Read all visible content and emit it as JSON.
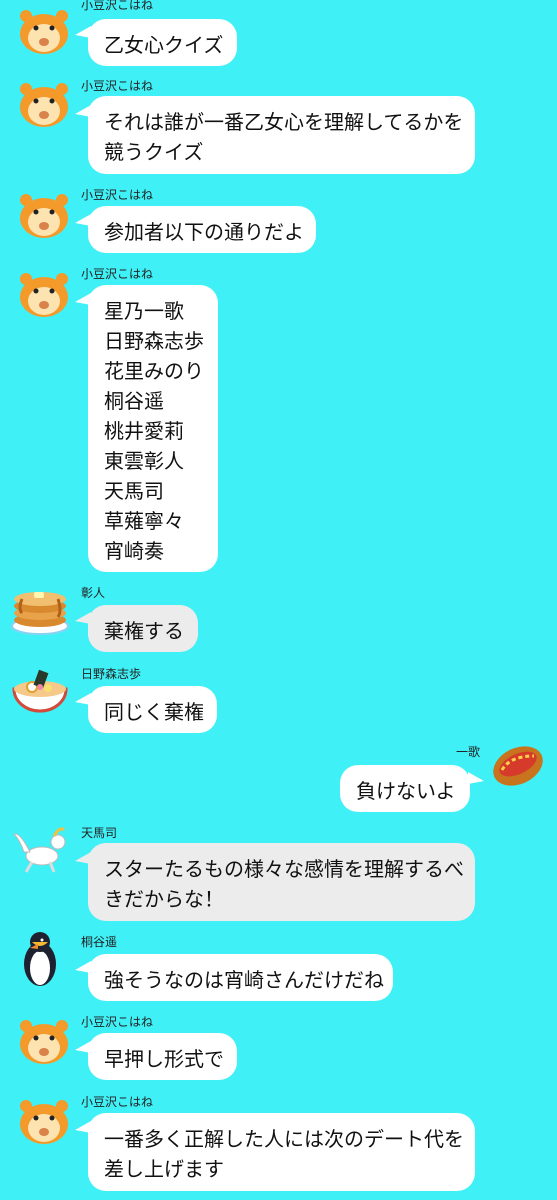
{
  "colors": {
    "background": "#3ff0f6",
    "bubble_incoming": "#ffffff",
    "bubble_other": "#ececec"
  },
  "messages": [
    {
      "name": "小豆沢こはね",
      "avatar": "hamster-icon",
      "lines": [
        "乙女心クイズ"
      ]
    },
    {
      "name": "小豆沢こはね",
      "avatar": "hamster-icon",
      "lines": [
        "それは誰が一番乙女心を理解してるかを",
        "競うクイズ"
      ]
    },
    {
      "name": "小豆沢こはね",
      "avatar": "hamster-icon",
      "lines": [
        "参加者以下の通りだよ"
      ]
    },
    {
      "name": "小豆沢こはね",
      "avatar": "hamster-icon",
      "lines": [
        "星乃一歌",
        "日野森志歩",
        "花里みのり",
        "桐谷遥",
        "桃井愛莉",
        "東雲彰人",
        "天馬司",
        "草薙寧々",
        "宵崎奏"
      ]
    },
    {
      "name": "彰人",
      "avatar": "pancake-icon",
      "lines": [
        "棄権する"
      ]
    },
    {
      "name": "日野森志歩",
      "avatar": "ramen-icon",
      "lines": [
        "同じく棄権"
      ]
    },
    {
      "name": "一歌",
      "avatar": "hotdog-icon",
      "lines": [
        "負けないよ"
      ]
    },
    {
      "name": "天馬司",
      "avatar": "pegasus-icon",
      "lines": [
        "スターたるもの様々な感情を理解するべ",
        "きだからな！"
      ]
    },
    {
      "name": "桐谷遥",
      "avatar": "penguin-icon",
      "lines": [
        "強そうなのは宵崎さんだけだね"
      ]
    },
    {
      "name": "小豆沢こはね",
      "avatar": "hamster-icon",
      "lines": [
        "早押し形式で"
      ]
    },
    {
      "name": "小豆沢こはね",
      "avatar": "hamster-icon",
      "lines": [
        "一番多く正解した人には次のデート代を",
        "差し上げます"
      ]
    }
  ]
}
